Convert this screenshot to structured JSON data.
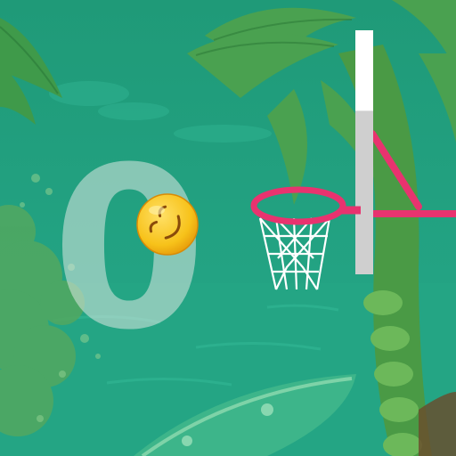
{
  "game": {
    "score": "0"
  },
  "colors": {
    "background": "#1f9a78",
    "sea": "#23a383",
    "foliage": "#3f9a4a",
    "hoop_rim": "#e8336f",
    "net": "#ffffff",
    "ball": "#f7c21a",
    "surfboard": "#3db58a"
  },
  "icons": {
    "ball": "emoji-ball-icon",
    "hoop": "basketball-hoop-icon",
    "backboard": "backboard-icon"
  },
  "shot_meter": {
    "level": 0.33
  }
}
